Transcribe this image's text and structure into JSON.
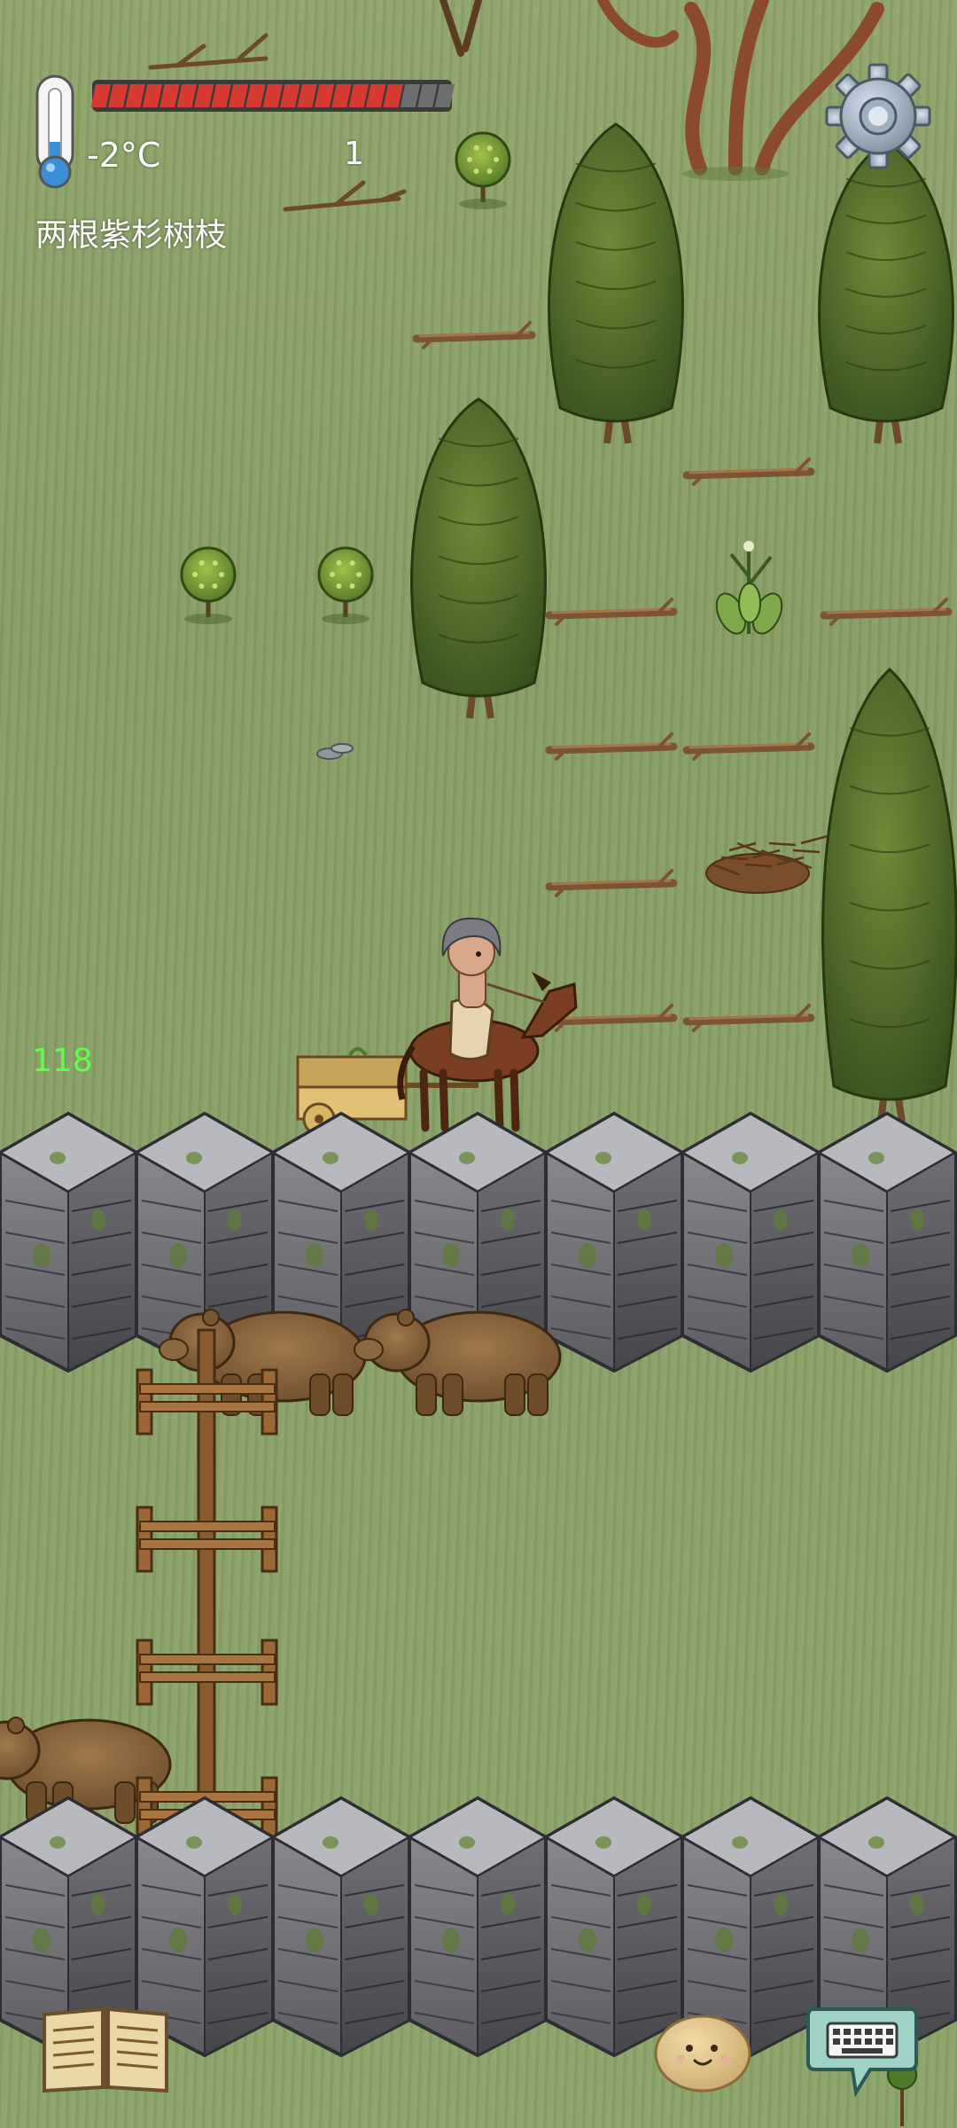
{
  "hud": {
    "temperature": "-2°C",
    "held_count": "1",
    "held_item_name": "两根紫杉树枝",
    "fps": "118",
    "food_meter": {
      "filled": 18,
      "total": 21
    },
    "colors": {
      "food_filled": "#d63a32",
      "food_empty": "#6e6e6e",
      "fps_text": "#5dff4a"
    }
  },
  "icons": {
    "thermometer": "thermometer-icon",
    "settings": "gear-icon",
    "journal": "open-book-icon",
    "emote": "potato-face-icon",
    "chat": "keyboard-speech-bubble-icon"
  },
  "scene": {
    "ground": "grass",
    "objects": [
      "yew-tree",
      "yew-branch",
      "gooseberry-bush",
      "milkweed-plant",
      "kindling-pile",
      "flat-stones",
      "horse-cart",
      "player-on-horse",
      "stone-wall",
      "wooden-fence",
      "grizzly-bear"
    ]
  }
}
